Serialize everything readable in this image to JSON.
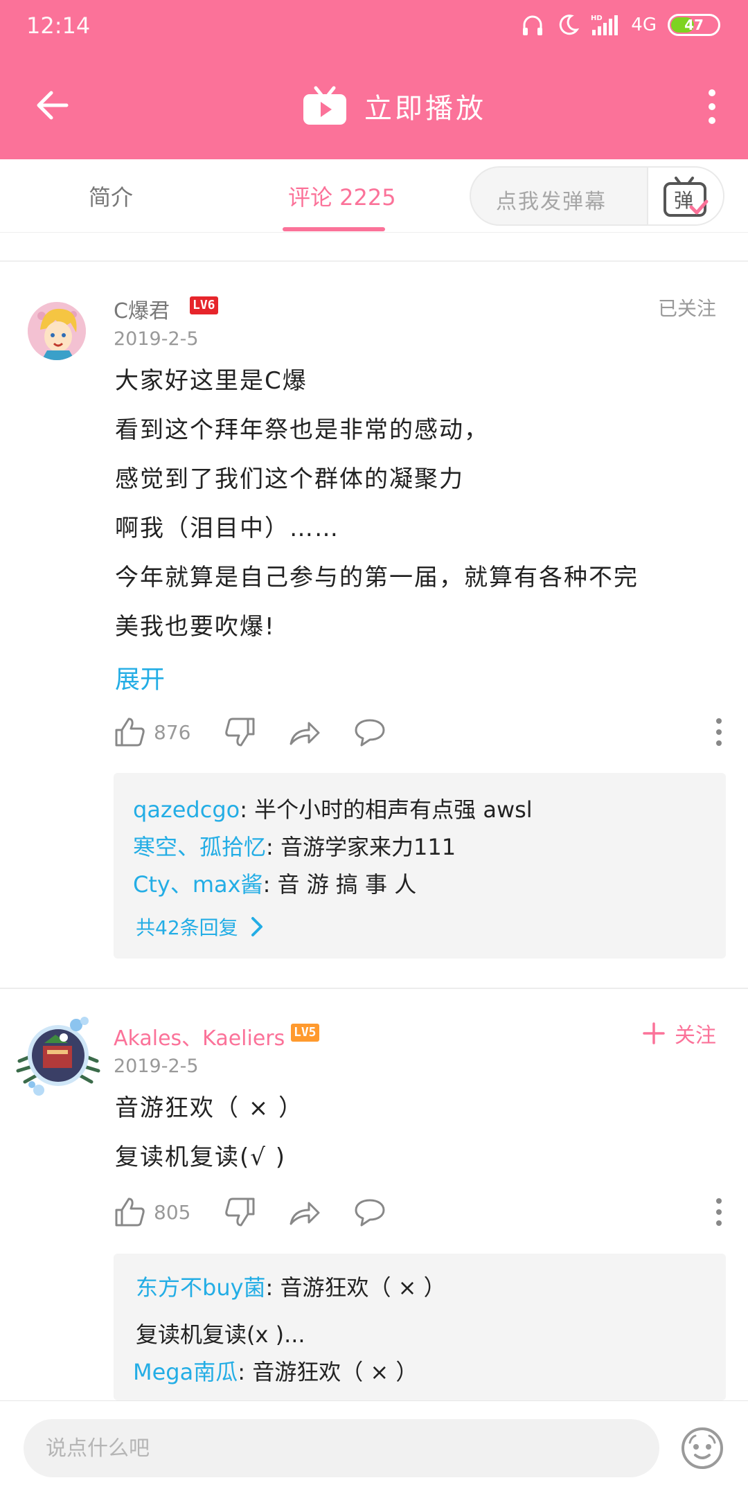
{
  "status_bar": {
    "time": "12:14",
    "network": "4G",
    "battery": "47",
    "battery_level": 0.47
  },
  "header": {
    "play_now_label": "立即播放",
    "colors": {
      "brand_pink": "#fb7299",
      "link_blue": "#23ade5"
    }
  },
  "tabs": {
    "intro_label": "简介",
    "comments_label": "评论 2225",
    "active": "comments"
  },
  "danmaku": {
    "placeholder": "点我发弹幕",
    "button_label": "弹"
  },
  "comments": [
    {
      "username": "C爆君",
      "level": "LV6",
      "level_color": "#e6252b",
      "follow_label": "已关注",
      "followed": true,
      "date": "2019-2-5",
      "lines": [
        "大家好这里是C爆",
        "看到这个拜年祭也是非常的感动，",
        "感觉到了我们这个群体的凝聚力",
        "啊我（泪目中）……",
        "今年就算是自己参与的第一届，就算有各种不完",
        "美我也要吹爆!"
      ],
      "expand_label": "展开",
      "likes": "876",
      "replies": [
        {
          "user": "qazedcgo",
          "text": ": 半个小时的相声有点强 awsl"
        },
        {
          "user": "寒空、孤拾忆",
          "text": ": 音游学家来力111"
        },
        {
          "user": "Cty、max酱",
          "text": ": 音 游 搞 事 人"
        }
      ],
      "reply_count_label": "共42条回复"
    },
    {
      "username": "Akales、Kaeliers",
      "level": "LV5",
      "level_color": "#ff9a2e",
      "follow_label": "关注",
      "followed": false,
      "date": "2019-2-5",
      "lines": [
        "音游狂欢（ × ）",
        "复读机复读(√ )"
      ],
      "likes": "805",
      "replies": [
        {
          "user": "东方不buy菌",
          "text": ": 音游狂欢（ × ）"
        },
        {
          "user": "",
          "text": "复读机复读(x )..."
        },
        {
          "user": "Mega南瓜",
          "text": ": 音游狂欢（ × ）"
        }
      ]
    }
  ],
  "bottom_bar": {
    "input_placeholder": "说点什么吧"
  }
}
